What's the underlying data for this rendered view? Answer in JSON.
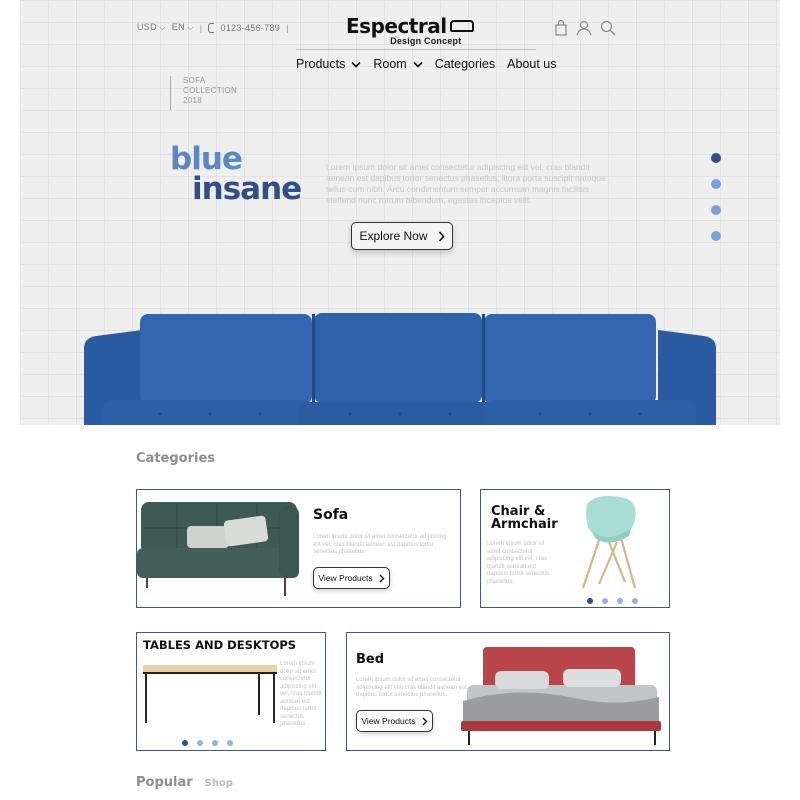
{
  "header": {
    "currency": "USD",
    "language": "EN",
    "phone": "0123-456-789",
    "brand": "Espectral",
    "tagline": "Design Concept",
    "icons": [
      "bag-icon",
      "user-icon",
      "search-icon"
    ]
  },
  "nav": {
    "items": [
      {
        "label": "Products",
        "has_dropdown": true
      },
      {
        "label": "Room",
        "has_dropdown": true
      },
      {
        "label": "Categories",
        "has_dropdown": false
      },
      {
        "label": "About us",
        "has_dropdown": false
      }
    ]
  },
  "hero": {
    "collection_lines": [
      "SOFA",
      "COLLECTION",
      "2018"
    ],
    "headline_1": "blue",
    "headline_2": "insane",
    "lorem": "Lorem ipsum dolor sit amet consectetur adipiscing elit vel, cras blandit aenean est dapibus tortor senectus phasellus, litora porta suscipit natoque tellus cum nibh. Arcu condimentum semper accumsan magnis facilisis eleifend nunc rutrum bibendum, egestas inceptos velit.",
    "cta": "Explore Now",
    "slides": 4,
    "active_slide": 0,
    "colors": {
      "headline_light": "#5b87c5",
      "headline_dark": "#2f4f86",
      "sofa": "#2c5fa8"
    }
  },
  "categories": {
    "title": "Categories",
    "cards": {
      "sofa": {
        "title": "Sofa",
        "lorem": "Lorem ipsum dolor sit amet consectetur adipiscing elit vel, cras blandit aenean est dapibus tortor senectus phasellus.",
        "button": "View Products"
      },
      "chair": {
        "title_1": "Chair &",
        "title_2": "Armchair",
        "lorem": "Lorem ipsum dolor sit amet consectetur adipiscing elit vel, cras blandit aenean est dapibus tortor senectus phasellus.",
        "slides": 4,
        "active_slide": 0
      },
      "tables": {
        "title": "TABLES AND DESKTOPS",
        "lorem": "Lorem ipsum dolor sit amet consectetur adipiscing elit vel, cras blandit aenean est dapibus tortor senectus phasellus.",
        "slides": 4,
        "active_slide": 0
      },
      "bed": {
        "title": "Bed",
        "lorem": "Lorem ipsum dolor sit amet consectetur adipiscing elit vel, cras blandit aenean est dapibus tortor senectus phasellus.",
        "button": "View Products"
      }
    }
  },
  "popular": {
    "title": "Popular",
    "link": "Shop"
  }
}
